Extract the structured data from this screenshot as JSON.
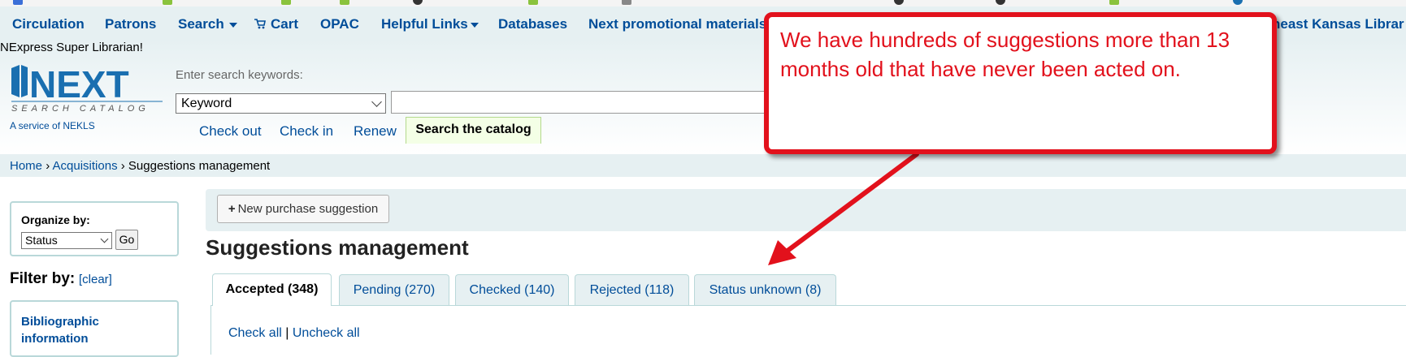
{
  "nav": {
    "items": [
      "Circulation",
      "Patrons",
      "Search",
      "Cart",
      "OPAC",
      "Helpful Links",
      "Databases",
      "Next promotional materials"
    ],
    "overflow_text": "heast Kansas Librar"
  },
  "header": {
    "logged_in_user": "NExpress Super Librarian!",
    "logo_text": "NEXT",
    "logo_subtitle": "SEARCH CATALOG",
    "service_text": "A service of NEKLS",
    "search_label": "Enter search keywords:",
    "search_select_value": "Keyword",
    "search_input_value": "",
    "tool_tabs": [
      "Check out",
      "Check in",
      "Renew"
    ],
    "search_catalog_tab": "Search the catalog"
  },
  "breadcrumbs": {
    "home": "Home",
    "sep": "›",
    "acquisitions": "Acquisitions",
    "current": "Suggestions management"
  },
  "sidebar": {
    "organize_label": "Organize by:",
    "organize_value": "Status",
    "go_label": "Go",
    "filter_label": "Filter by:",
    "clear_label": "[clear]",
    "bib_label": "Bibliographic information"
  },
  "main": {
    "new_button_icon": "+",
    "new_button_label": "New purchase suggestion",
    "title": "Suggestions management",
    "tabs": [
      {
        "label": "Accepted (348)"
      },
      {
        "label": "Pending (270)"
      },
      {
        "label": "Checked (140)"
      },
      {
        "label": "Rejected (118)"
      },
      {
        "label": "Status unknown (8)"
      }
    ],
    "check_all": "Check all",
    "separator": "|",
    "uncheck_all": "Uncheck all"
  },
  "annotation": {
    "text": "We have hundreds of suggestions more than 13 months old that have never been acted on.",
    "color": "#e2111c"
  },
  "colors": {
    "link": "#004d99",
    "nav_bg": "#e6f0f2",
    "border": "#b9d8d9",
    "annotation": "#e2111c"
  }
}
